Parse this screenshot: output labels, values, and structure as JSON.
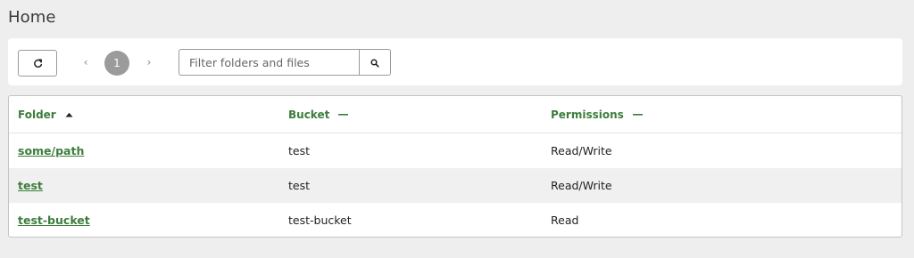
{
  "page": {
    "title": "Home"
  },
  "toolbar": {
    "refresh_icon": "refresh-icon",
    "pager": {
      "prev_glyph": "‹",
      "current_page": "1",
      "next_glyph": "›"
    },
    "search": {
      "placeholder": "Filter folders and files",
      "value": "",
      "icon": "search-icon"
    }
  },
  "table": {
    "columns": [
      {
        "label": "Folder",
        "sort": "ascending"
      },
      {
        "label": "Bucket",
        "sort": "none"
      },
      {
        "label": "Permissions",
        "sort": "none"
      }
    ],
    "rows": [
      {
        "folder": "some/path",
        "bucket": "test",
        "permissions": "Read/Write"
      },
      {
        "folder": "test",
        "bucket": "test",
        "permissions": "Read/Write"
      },
      {
        "folder": "test-bucket",
        "bucket": "test-bucket",
        "permissions": "Read"
      }
    ]
  },
  "colors": {
    "accent": "#3c7d3c",
    "page_bg": "#eeeeee",
    "row_alt": "#f0f0f0",
    "pager_active": "#9b9b9b"
  }
}
